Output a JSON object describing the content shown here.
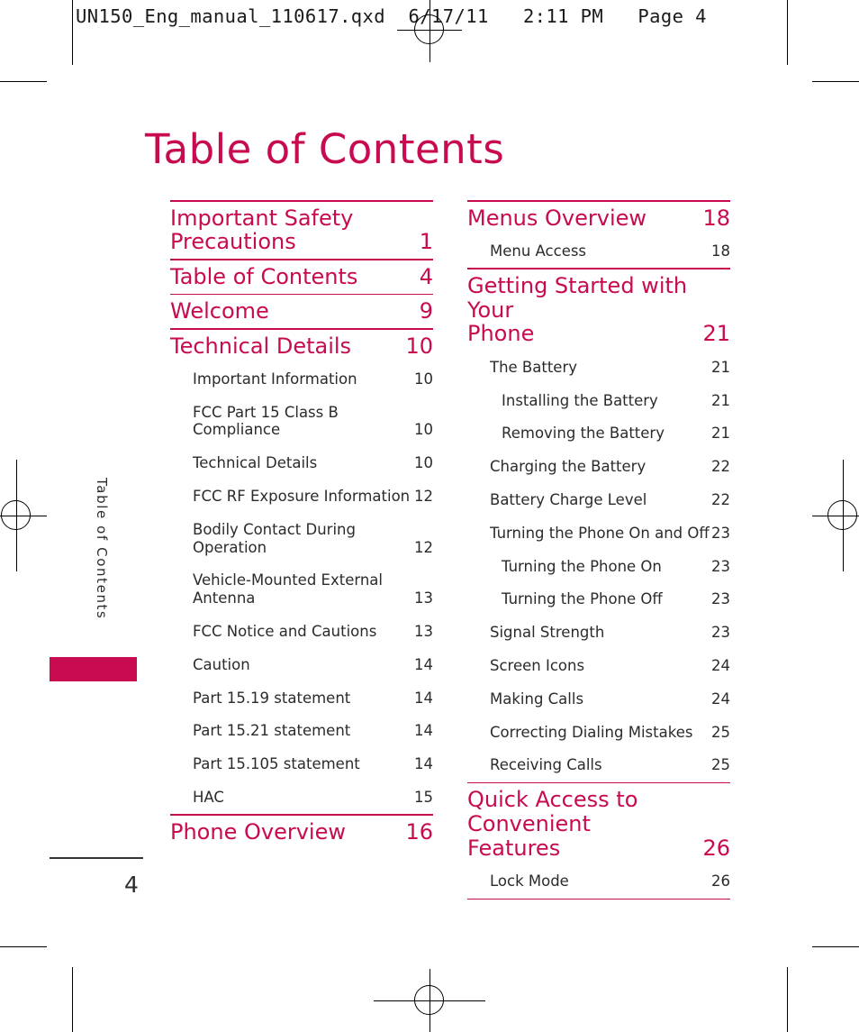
{
  "print_header": "UN150_Eng_manual_110617.qxd  6/17/11   2:11 PM   Page 4",
  "page_title": "Table of Contents",
  "side_tab": {
    "label": "Table of Contents"
  },
  "footer": {
    "page_number": "4"
  },
  "colors": {
    "accent": "#c80a50",
    "body_text": "#2b2b2b",
    "rule": "#c80a50"
  },
  "toc": {
    "left_column": [
      {
        "level": 0,
        "label": "Important Safety Precautions",
        "page": "1",
        "wrap": true,
        "line1": "Important Safety",
        "line2": "Precautions"
      },
      {
        "level": 0,
        "label": "Table of Contents",
        "page": "4"
      },
      {
        "level": 0,
        "label": "Welcome",
        "page": "9"
      },
      {
        "level": 0,
        "label": "Technical Details",
        "page": "10"
      },
      {
        "level": 1,
        "label": "Important Information",
        "page": "10"
      },
      {
        "level": 1,
        "label": "FCC Part 15 Class B Compliance",
        "page": "10"
      },
      {
        "level": 1,
        "label": "Technical Details",
        "page": "10"
      },
      {
        "level": 1,
        "label": "FCC RF Exposure Information",
        "page": "12"
      },
      {
        "level": 1,
        "label": "Bodily Contact During Operation",
        "page": "12"
      },
      {
        "level": 1,
        "label": "Vehicle-Mounted External Antenna",
        "page": "13",
        "wrap": true,
        "line1": "Vehicle-Mounted External",
        "line2": "Antenna"
      },
      {
        "level": 1,
        "label": "FCC Notice and Cautions",
        "page": "13"
      },
      {
        "level": 1,
        "label": "Caution",
        "page": "14"
      },
      {
        "level": 1,
        "label": "Part 15.19 statement",
        "page": "14"
      },
      {
        "level": 1,
        "label": "Part 15.21 statement",
        "page": "14"
      },
      {
        "level": 1,
        "label": "Part 15.105 statement",
        "page": "14"
      },
      {
        "level": 1,
        "label": "HAC",
        "page": "15"
      },
      {
        "level": 0,
        "label": "Phone Overview",
        "page": "16"
      }
    ],
    "right_column": [
      {
        "level": 0,
        "label": "Menus Overview",
        "page": "18"
      },
      {
        "level": 1,
        "label": "Menu Access",
        "page": "18"
      },
      {
        "level": 0,
        "label": "Getting Started with Your Phone",
        "page": "21",
        "wrap": true,
        "line1": "Getting Started with Your",
        "line2": "Phone"
      },
      {
        "level": 1,
        "label": "The Battery",
        "page": "21"
      },
      {
        "level": 2,
        "label": "Installing the Battery",
        "page": "21"
      },
      {
        "level": 2,
        "label": "Removing the Battery",
        "page": "21"
      },
      {
        "level": 1,
        "label": "Charging the Battery",
        "page": "22"
      },
      {
        "level": 1,
        "label": "Battery Charge Level",
        "page": "22"
      },
      {
        "level": 1,
        "label": "Turning the Phone On and Off",
        "page": "23"
      },
      {
        "level": 2,
        "label": "Turning the Phone On",
        "page": "23"
      },
      {
        "level": 2,
        "label": "Turning the Phone Off",
        "page": "23"
      },
      {
        "level": 1,
        "label": "Signal Strength",
        "page": "23"
      },
      {
        "level": 1,
        "label": "Screen Icons",
        "page": "24"
      },
      {
        "level": 1,
        "label": "Making Calls",
        "page": "24"
      },
      {
        "level": 1,
        "label": "Correcting Dialing Mistakes",
        "page": "25"
      },
      {
        "level": 1,
        "label": "Receiving Calls",
        "page": "25"
      },
      {
        "level": 0,
        "label": "Quick Access to Convenient Features",
        "page": "26",
        "wrap": true,
        "line1": "Quick Access to Convenient",
        "line2": "Features"
      },
      {
        "level": 1,
        "label": "Lock Mode",
        "page": "26"
      }
    ]
  }
}
